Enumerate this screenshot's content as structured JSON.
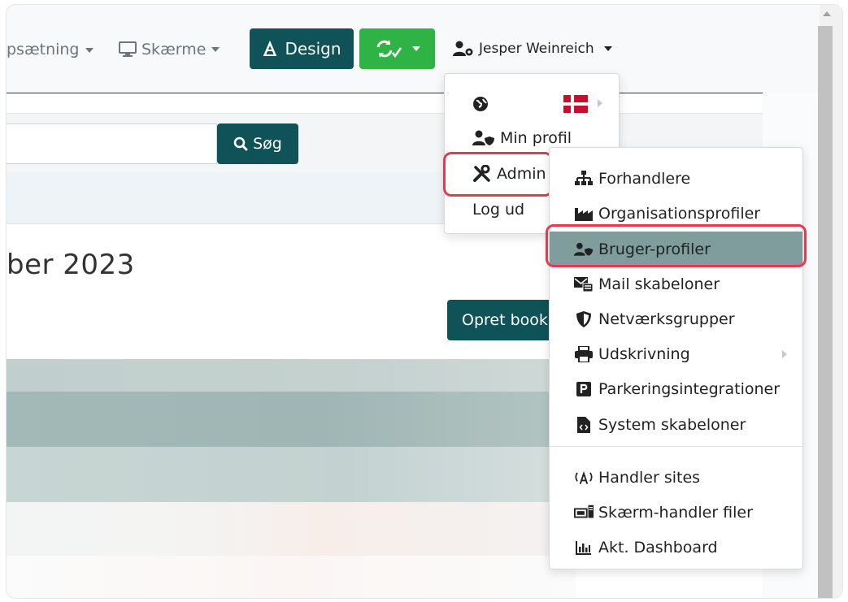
{
  "navbar": {
    "opsaetning_label": "psætning",
    "skaerme_label": "Skærme",
    "design_label": "Design",
    "user_name": "Jesper Weinreich"
  },
  "search": {
    "button_label": "Søg"
  },
  "page": {
    "title": "ber 2023",
    "create_button_label": "Opret book"
  },
  "user_menu": {
    "items": [
      {
        "label": ""
      },
      {
        "label": "Min profil"
      },
      {
        "label": "Admin"
      },
      {
        "label": "Log ud"
      }
    ]
  },
  "admin_menu": {
    "items": [
      {
        "label": "Forhandlere",
        "icon": "sitemap-icon"
      },
      {
        "label": "Organisationsprofiler",
        "icon": "industry-icon"
      },
      {
        "label": "Bruger-profiler",
        "icon": "user-shield-icon"
      },
      {
        "label": "Mail skabeloner",
        "icon": "mail-template-icon"
      },
      {
        "label": "Netværksgrupper",
        "icon": "shield-icon"
      },
      {
        "label": "Udskrivning",
        "icon": "printer-icon"
      },
      {
        "label": "Parkeringsintegrationer",
        "icon": "parking-icon"
      },
      {
        "label": "System skabeloner",
        "icon": "file-code-icon"
      },
      {
        "label": "Handler sites",
        "icon": "broadcast-icon"
      },
      {
        "label": "Skærm-handler filer",
        "icon": "screen-files-icon"
      },
      {
        "label": "Akt. Dashboard",
        "icon": "chart-icon"
      }
    ]
  },
  "colors": {
    "primary_teal": "#0f5257",
    "success_green": "#2fb344",
    "active_item": "#7f9d9d",
    "highlight_red": "#e8394d"
  }
}
